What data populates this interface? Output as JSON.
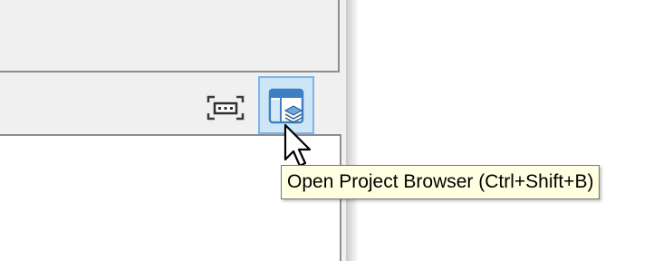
{
  "tooltip": {
    "text": "Open Project Browser (Ctrl+Shift+B)"
  },
  "toolbar": {
    "buttons": [
      {
        "icon": "fit-view-icon",
        "state": "normal"
      },
      {
        "icon": "project-browser-icon",
        "state": "hover"
      }
    ]
  },
  "colors": {
    "hover_fill": "#cde6f7",
    "hover_border": "#7eb4ea",
    "tooltip_bg": "#ffffe1",
    "icon_blue": "#3c7fc2",
    "panel_bg": "#f0f0f0"
  },
  "cursor": "arrow-pointer-icon"
}
